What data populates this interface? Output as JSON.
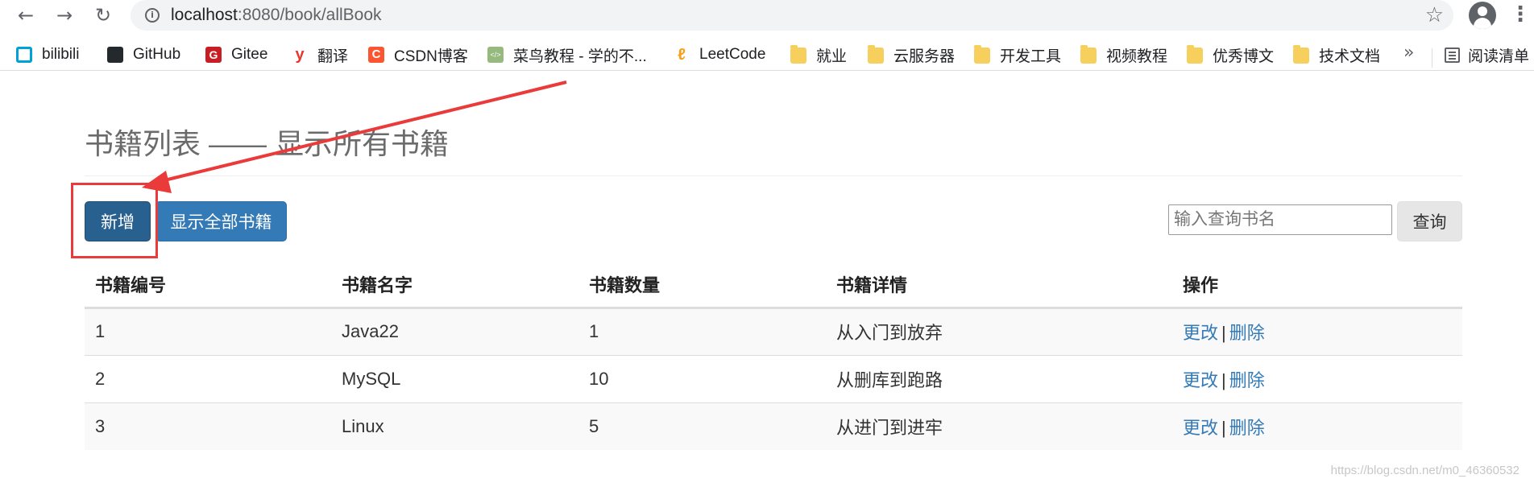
{
  "browser": {
    "url_host": "localhost",
    "url_path": ":8080/book/allBook",
    "icons": {
      "back": "arrow-left-icon",
      "forward": "arrow-right-icon",
      "reload": "reload-icon",
      "info": "info-icon",
      "star": "star-icon",
      "profile": "profile-icon",
      "menu": "kebab-menu-icon"
    }
  },
  "bookmarks": {
    "items": [
      {
        "label": "bilibili",
        "icon": "bilibili-icon"
      },
      {
        "label": "GitHub",
        "icon": "github-icon"
      },
      {
        "label": "Gitee",
        "icon": "gitee-icon"
      },
      {
        "label": "翻译",
        "icon": "youdao-icon"
      },
      {
        "label": "CSDN博客",
        "icon": "csdn-icon"
      },
      {
        "label": "菜鸟教程 - 学的不...",
        "icon": "runoob-icon"
      },
      {
        "label": "LeetCode",
        "icon": "leetcode-icon"
      },
      {
        "label": "就业",
        "icon": "folder-icon"
      },
      {
        "label": "云服务器",
        "icon": "folder-icon"
      },
      {
        "label": "开发工具",
        "icon": "folder-icon"
      },
      {
        "label": "视频教程",
        "icon": "folder-icon"
      },
      {
        "label": "优秀博文",
        "icon": "folder-icon"
      },
      {
        "label": "技术文档",
        "icon": "folder-icon"
      }
    ],
    "more": "»",
    "reading_list": "阅读清单"
  },
  "page": {
    "title": "书籍列表 —— 显示所有书籍",
    "add_button": "新增",
    "show_all_button": "显示全部书籍",
    "search_placeholder": "输入查询书名",
    "search_button": "查询",
    "annotation_color": "#ea3a3a"
  },
  "table": {
    "headers": [
      "书籍编号",
      "书籍名字",
      "书籍数量",
      "书籍详情",
      "操作"
    ],
    "rows": [
      {
        "id": "1",
        "name": "Java22",
        "count": "1",
        "detail": "从入门到放弃"
      },
      {
        "id": "2",
        "name": "MySQL",
        "count": "10",
        "detail": "从删库到跑路"
      },
      {
        "id": "3",
        "name": "Linux",
        "count": "5",
        "detail": "从进门到进牢"
      }
    ],
    "action_edit": "更改",
    "action_sep": "|",
    "action_delete": "删除"
  },
  "watermark": "https://blog.csdn.net/m0_46360532"
}
